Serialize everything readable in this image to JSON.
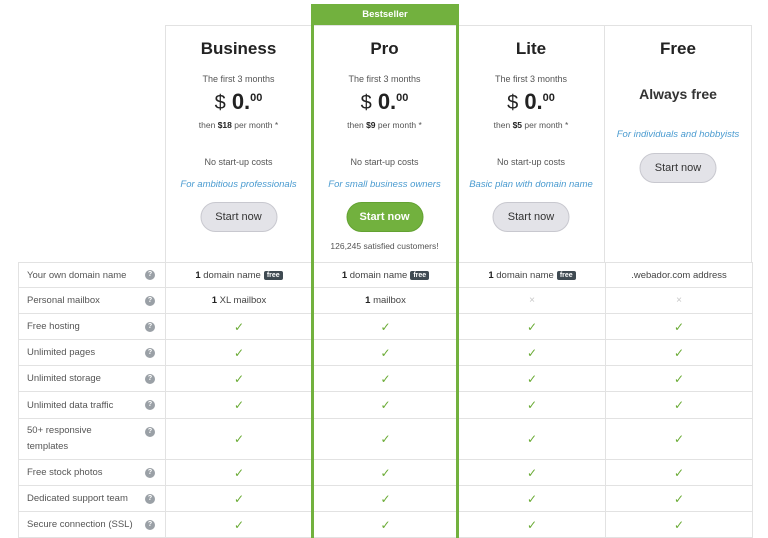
{
  "bestseller_label": "Bestseller",
  "plans": [
    {
      "name": "Business",
      "first_period": "The first 3 months",
      "currency": "$",
      "price_int": "0.",
      "price_dec": "00",
      "then_prefix": "then ",
      "then_amount": "$18",
      "then_suffix": " per month *",
      "no_startup": "No start-up costs",
      "tagline": "For ambitious professionals",
      "button": "Start now"
    },
    {
      "name": "Pro",
      "first_period": "The first 3 months",
      "currency": "$",
      "price_int": "0.",
      "price_dec": "00",
      "then_prefix": "then ",
      "then_amount": "$9",
      "then_suffix": " per month *",
      "no_startup": "No start-up costs",
      "tagline": "For small business owners",
      "button": "Start now",
      "satisfied": "126,245 satisfied customers!"
    },
    {
      "name": "Lite",
      "first_period": "The first 3 months",
      "currency": "$",
      "price_int": "0.",
      "price_dec": "00",
      "then_prefix": "then ",
      "then_amount": "$5",
      "then_suffix": " per month *",
      "no_startup": "No start-up costs",
      "tagline": "Basic plan with domain name",
      "button": "Start now"
    },
    {
      "name": "Free",
      "price_text": "Always free",
      "tagline": "For individuals and hobbyists",
      "button": "Start now"
    }
  ],
  "help_glyph": "?",
  "check_glyph": "✓",
  "cross_glyph": "×",
  "features": {
    "domain": {
      "label": "Your own domain name",
      "count": "1",
      "text": " domain name",
      "badge": "free",
      "free_value": ".webador.com address"
    },
    "mailbox": {
      "label": "Personal mailbox",
      "business_count": "1",
      "business_text": " XL mailbox",
      "pro_count": "1",
      "pro_text": " mailbox"
    },
    "check_rows": [
      "Free hosting",
      "Unlimited pages",
      "Unlimited storage",
      "Unlimited data traffic",
      "50+ responsive templates",
      "Free stock photos",
      "Dedicated support team",
      "Secure connection (SSL)"
    ]
  },
  "colors": {
    "accent_green": "#72b13e",
    "link_blue": "#4a9bd0",
    "badge_dark": "#3f4a52"
  }
}
